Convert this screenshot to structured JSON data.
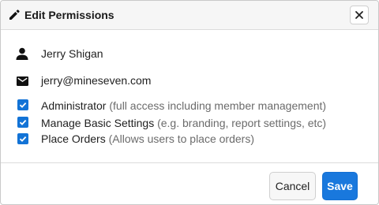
{
  "dialog": {
    "title": "Edit Permissions",
    "title_icon": "pencil-icon",
    "close_icon": "close-icon"
  },
  "user": {
    "name": "Jerry Shigan",
    "name_icon": "person-icon",
    "email": "jerry@mineseven.com",
    "email_icon": "envelope-icon"
  },
  "permissions": [
    {
      "name": "Administrator",
      "description": "(full access including member management)",
      "checked": true
    },
    {
      "name": "Manage Basic Settings",
      "description": "(e.g. branding, report settings, etc)",
      "checked": true
    },
    {
      "name": "Place Orders",
      "description": "(Allows users to place orders)",
      "checked": true
    }
  ],
  "footer": {
    "cancel_label": "Cancel",
    "save_label": "Save"
  },
  "colors": {
    "accent": "#1978dd",
    "checkbox": "#1273d6"
  }
}
